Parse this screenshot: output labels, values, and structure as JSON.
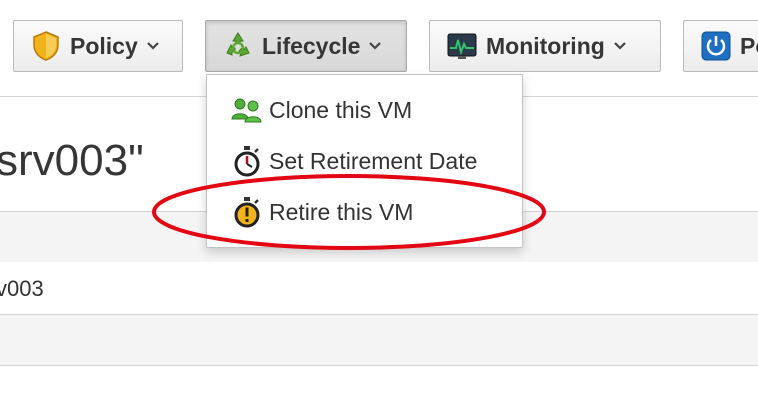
{
  "toolbar": {
    "buttons": [
      {
        "label": "Policy",
        "icon": "shield-icon"
      },
      {
        "label": "Lifecycle",
        "icon": "recycle-icon"
      },
      {
        "label": "Monitoring",
        "icon": "monitor-chart-icon"
      },
      {
        "label": "Po",
        "icon": "power-icon"
      }
    ]
  },
  "lifecycle_menu": {
    "items": [
      {
        "label": "Clone this VM",
        "icon": "clone-users-icon"
      },
      {
        "label": "Set Retirement Date",
        "icon": "stopwatch-icon"
      },
      {
        "label": "Retire this VM",
        "icon": "stopwatch-warning-icon"
      }
    ]
  },
  "page": {
    "title": "srv003\"",
    "row_value": "v003"
  },
  "colors": {
    "highlight": "#e30613",
    "shield": "#f2b21b",
    "recycle": "#5aa830",
    "power": "#1e6fc1"
  }
}
